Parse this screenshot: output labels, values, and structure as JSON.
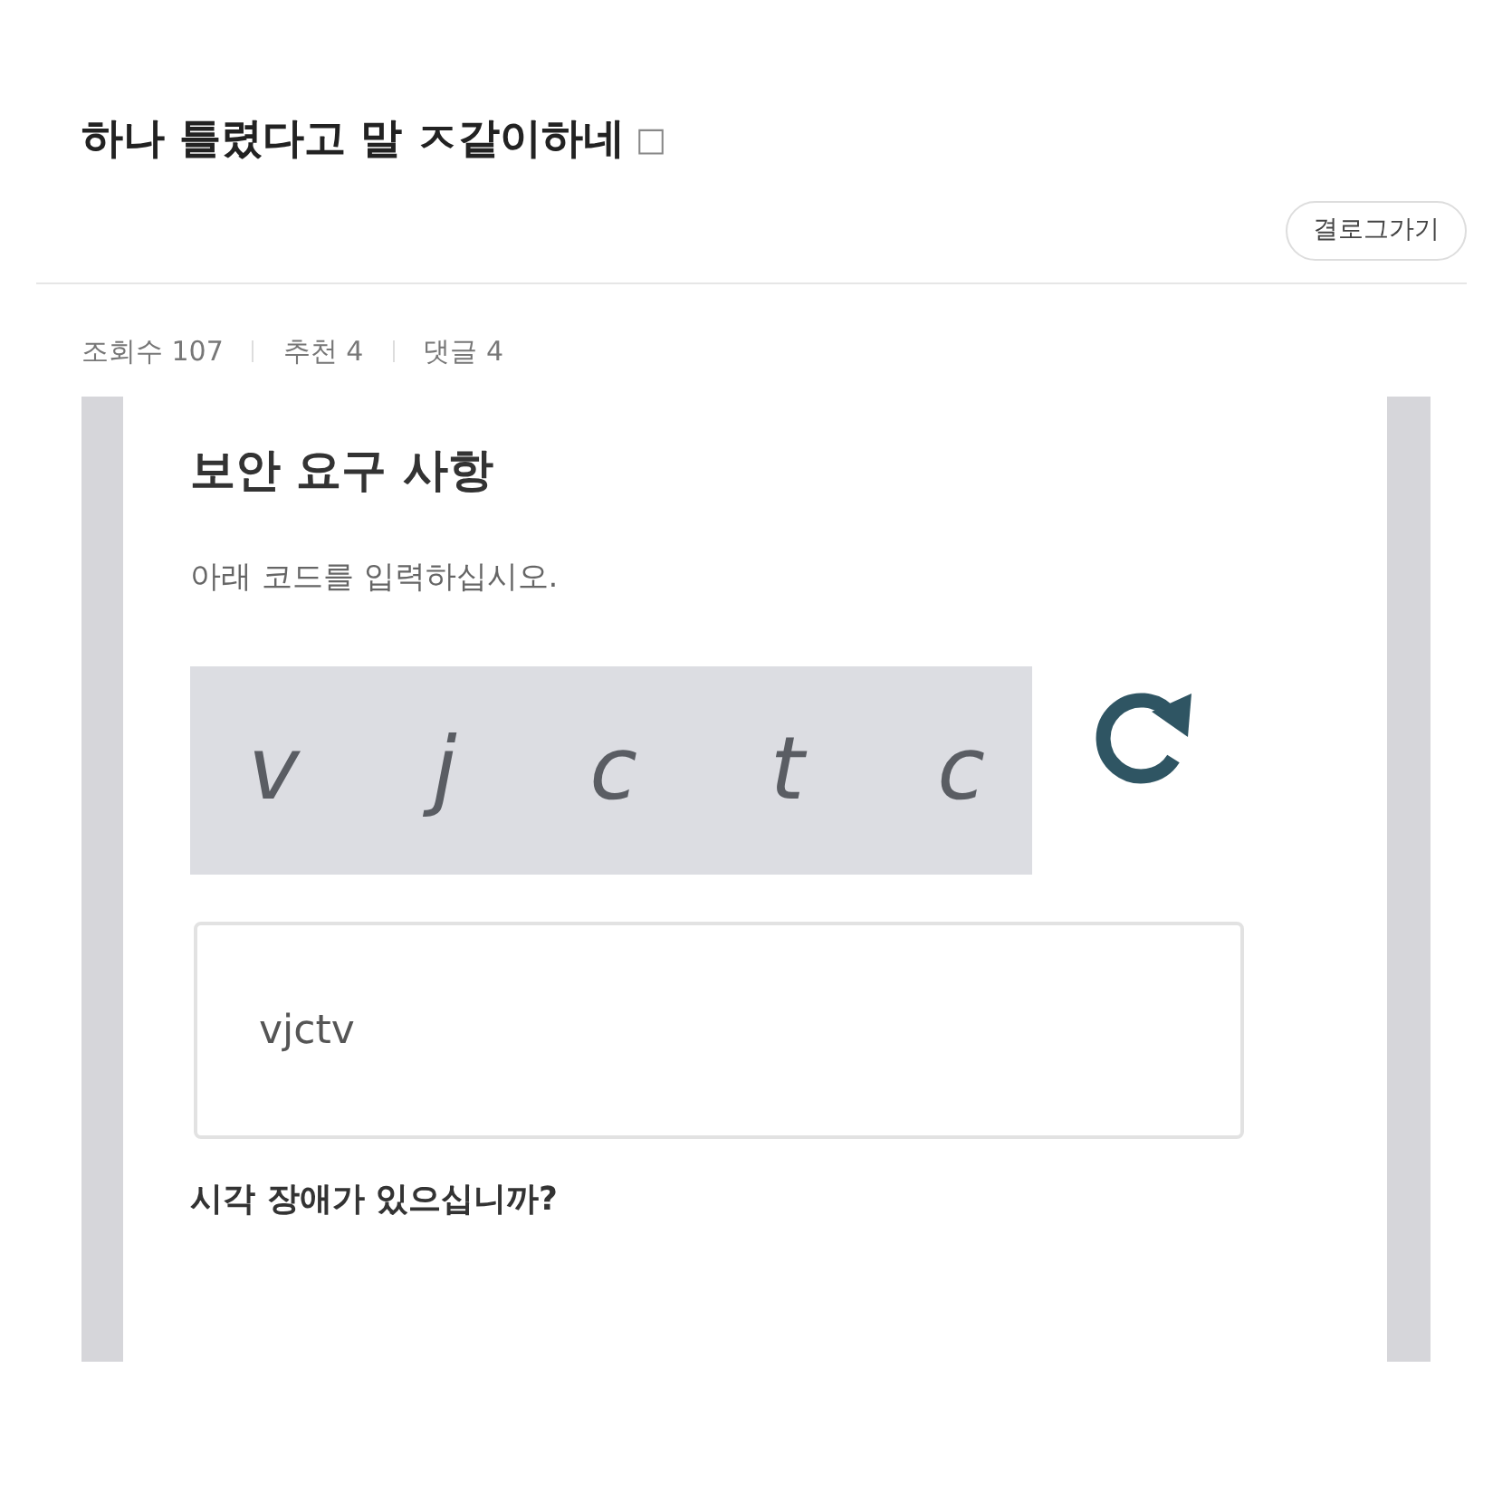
{
  "post": {
    "title": "하나 틀렸다고 말 ㅈ같이하네",
    "title_mark": "□",
    "back_button": "결로그가기",
    "stats": [
      "조회수 107",
      "추천 4",
      "댓글 4"
    ]
  },
  "captcha_screen": {
    "heading": "보안 요구 사항",
    "instruction": "아래 코드를 입력하십시오.",
    "captcha_letters": [
      "v",
      "j",
      "c",
      "t",
      "c"
    ],
    "answer_value": "vjctv",
    "help_link": "시각 장애가 있으십니까?"
  }
}
